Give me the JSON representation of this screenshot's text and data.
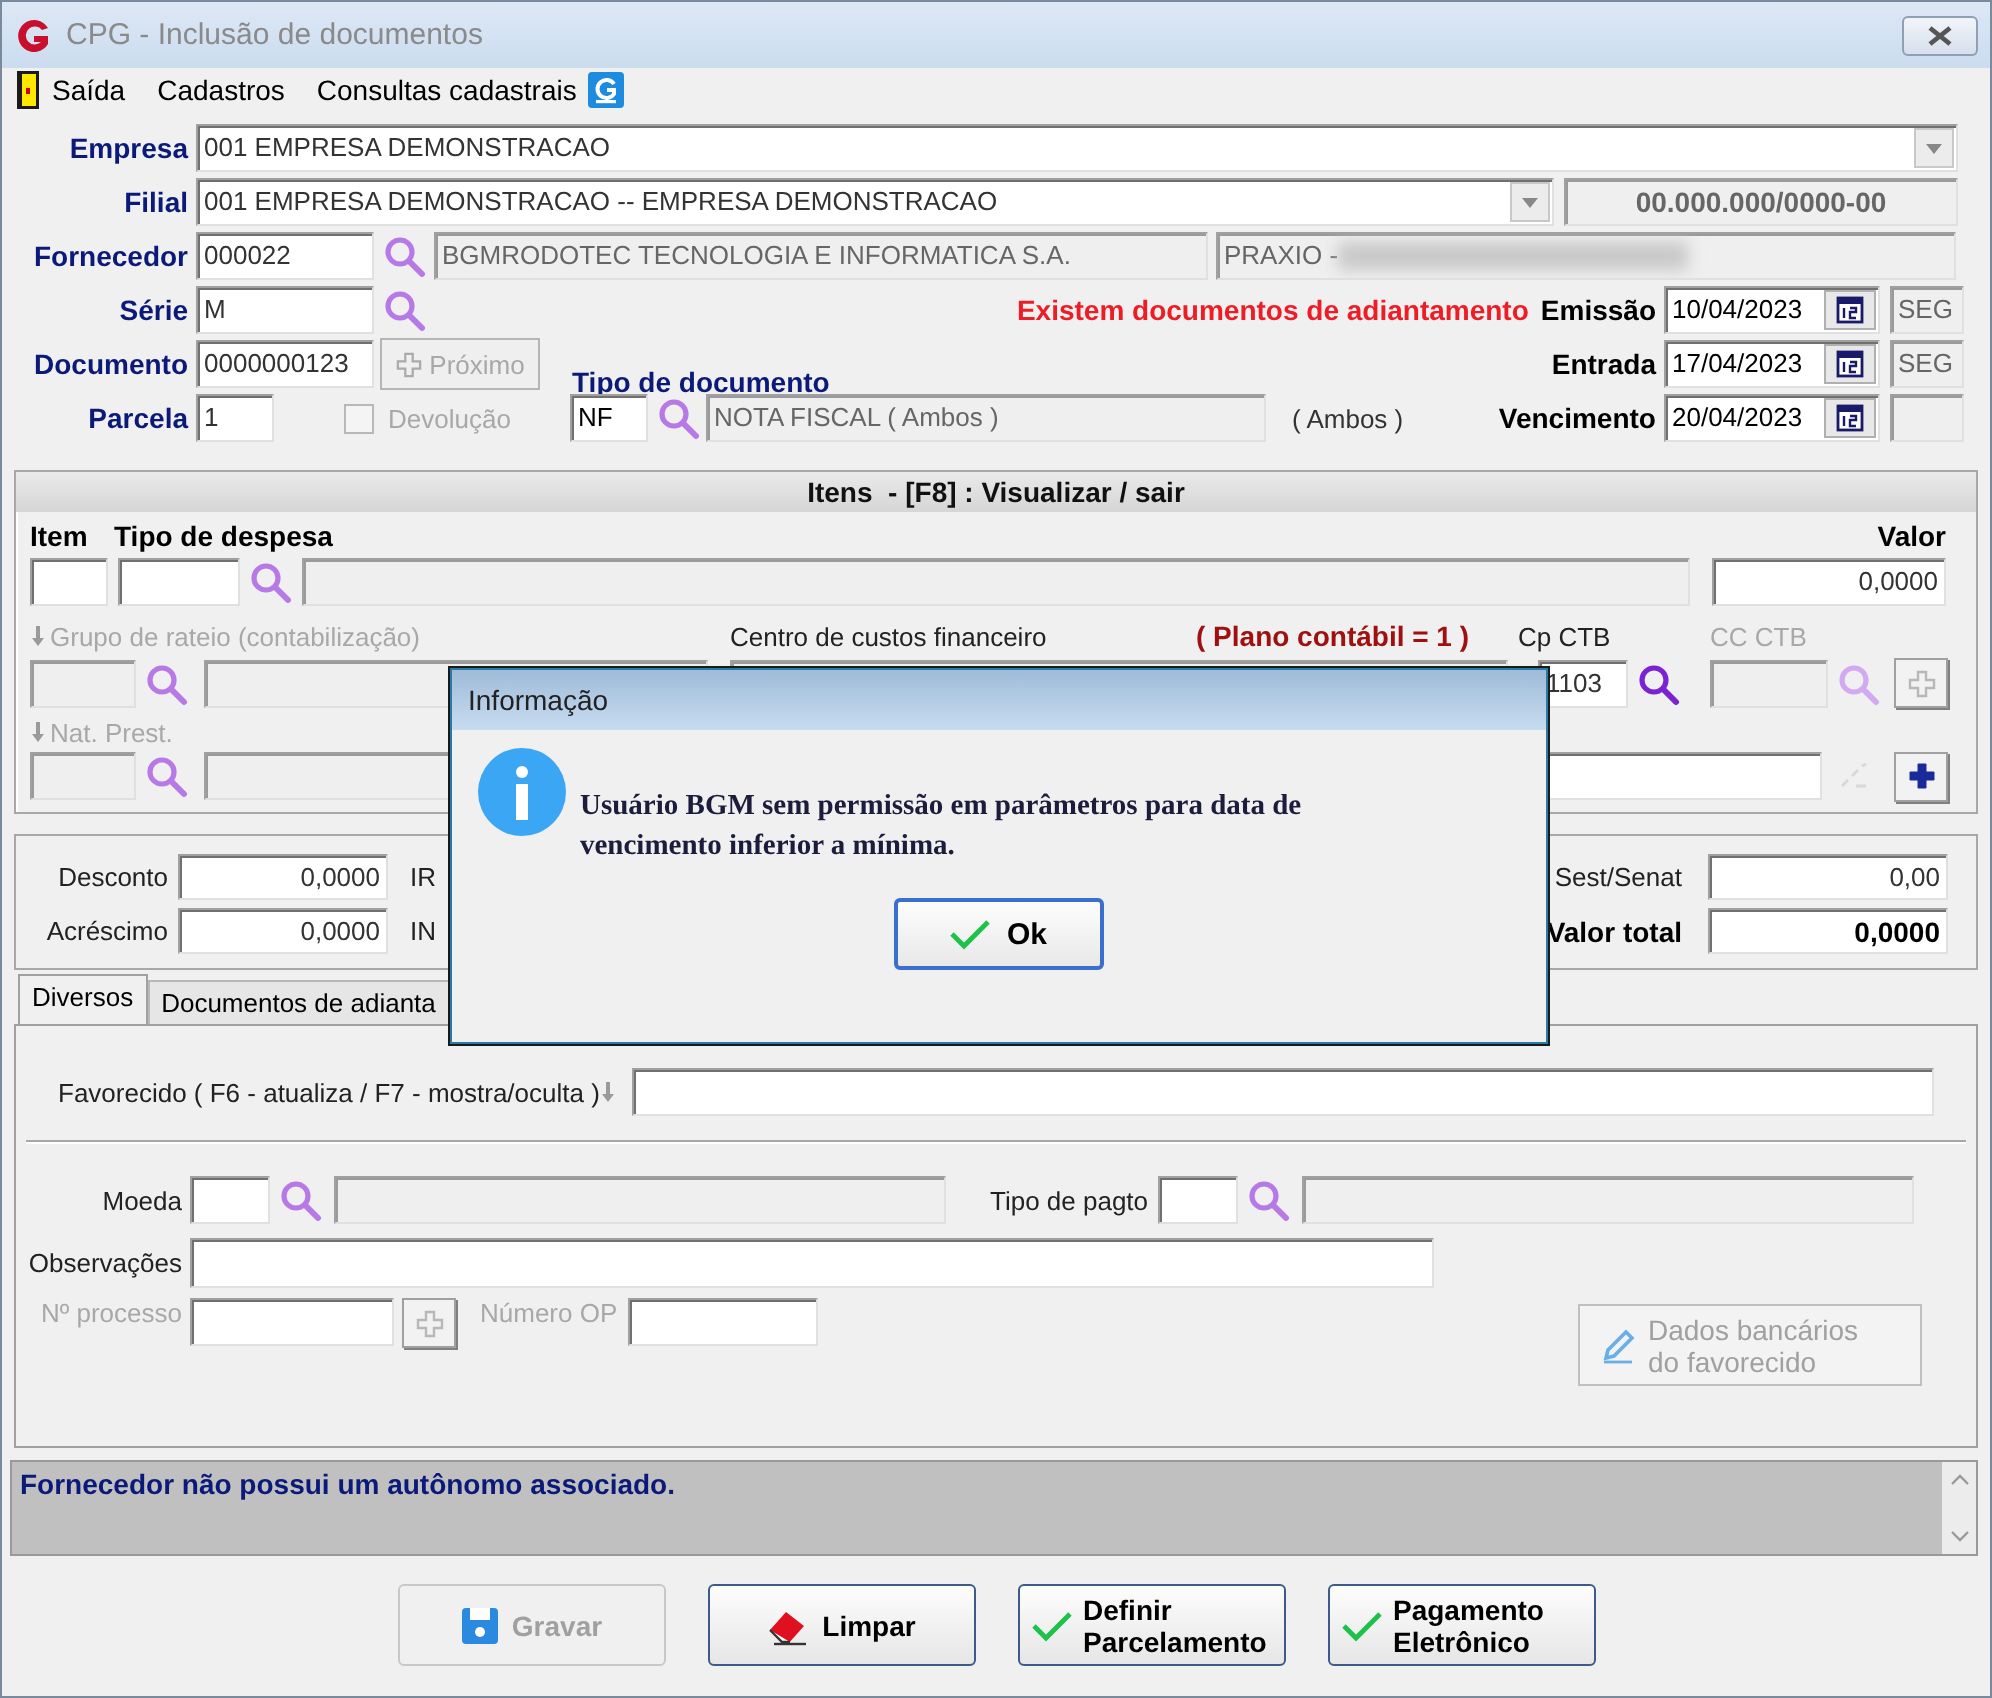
{
  "window": {
    "title": "CPG - Inclusão de documentos"
  },
  "menu": [
    {
      "label": "Saída"
    },
    {
      "label": "Cadastros"
    },
    {
      "label": "Consultas cadastrais"
    }
  ],
  "header": {
    "empresa": {
      "label": "Empresa",
      "value": "001 EMPRESA DEMONSTRACAO"
    },
    "filial": {
      "label": "Filial",
      "value": "001 EMPRESA DEMONSTRACAO -- EMPRESA DEMONSTRACAO",
      "cnpj": "00.000.000/0000-00"
    },
    "fornecedor": {
      "label": "Fornecedor",
      "code": "000022",
      "name": "BGMRODOTEC TECNOLOGIA E INFORMATICA S.A.",
      "group": "PRAXIO -"
    },
    "serie": {
      "label": "Série",
      "value": "M"
    },
    "warning": "Existem documentos de adiantamento",
    "documento": {
      "label": "Documento",
      "value": "0000000123"
    },
    "next_button": {
      "label": "Próximo",
      "disabled": true
    },
    "parcela": {
      "label": "Parcela",
      "value": "1"
    },
    "devolucao": {
      "label": "Devolução",
      "checked": false,
      "disabled": true
    },
    "tipo_documento": {
      "label": "Tipo de documento",
      "code": "NF",
      "description": "NOTA FISCAL ( Ambos )",
      "note": "( Ambos )"
    },
    "dates": [
      {
        "label": "Emissão",
        "value": "10/04/2023",
        "weekday": "SEG"
      },
      {
        "label": "Entrada",
        "value": "17/04/2023",
        "weekday": "SEG"
      },
      {
        "label": "Vencimento",
        "value": "20/04/2023"
      }
    ]
  },
  "items": {
    "title": "Itens  - [F8] : Visualizar / sair",
    "item_label": "Item",
    "tipo_label": "Tipo de despesa",
    "valor_label": "Valor",
    "valor": "0,0000",
    "grupo": {
      "label": "Grupo de rateio (contabilização)",
      "disabled": true
    },
    "centro_label": "Centro de custos financeiro",
    "plano": "( Plano contábil = 1 )",
    "cp_ctb": {
      "label": "Cp CTB",
      "value": "1103"
    },
    "cc_ctb": {
      "label": "CC CTB",
      "disabled": true
    },
    "nat_prest": {
      "label": "Nat. Prest.",
      "disabled": true
    }
  },
  "totals": {
    "left": [
      {
        "label": "Desconto",
        "value": "0,0000",
        "tax_label": "IR"
      },
      {
        "label": "Acréscimo",
        "value": "0,0000",
        "tax_label": "IN"
      }
    ],
    "right": [
      {
        "label": "Sest/Senat",
        "value": "0,00",
        "kind": "plain"
      },
      {
        "label": "Valor total",
        "value": "0,0000",
        "kind": "total"
      }
    ]
  },
  "tabs": [
    {
      "label": "Diversos",
      "selected": true
    },
    {
      "label": "Documentos de adianta",
      "selected": false
    }
  ],
  "diversos": {
    "favorecido_label": "Favorecido ( F6 - atualiza / F7 - mostra/oculta )",
    "moeda_label": "Moeda",
    "tipo_pagto_label": "Tipo de pagto",
    "observacoes_label": "Observações",
    "processo": {
      "label": "Nº processo",
      "disabled": true
    },
    "numero_op": {
      "label": "Número OP",
      "disabled": true
    },
    "bank_button": {
      "label": "Dados bancários do favorecido",
      "disabled": true
    }
  },
  "status_message": "Fornecedor não possui um autônomo associado.",
  "buttons": [
    {
      "label": "Gravar",
      "kind": "save",
      "disabled": true
    },
    {
      "label": "Limpar",
      "kind": "clear",
      "disabled": false
    },
    {
      "label": "Definir Parcelamento",
      "kind": "check",
      "disabled": false
    },
    {
      "label": "Pagamento Eletrônico",
      "kind": "check",
      "disabled": false
    }
  ],
  "dialog": {
    "title": "Informação",
    "message": "Usuário BGM sem permissão em parâmetros para data de vencimento inferior a mínima.",
    "button": "Ok"
  }
}
